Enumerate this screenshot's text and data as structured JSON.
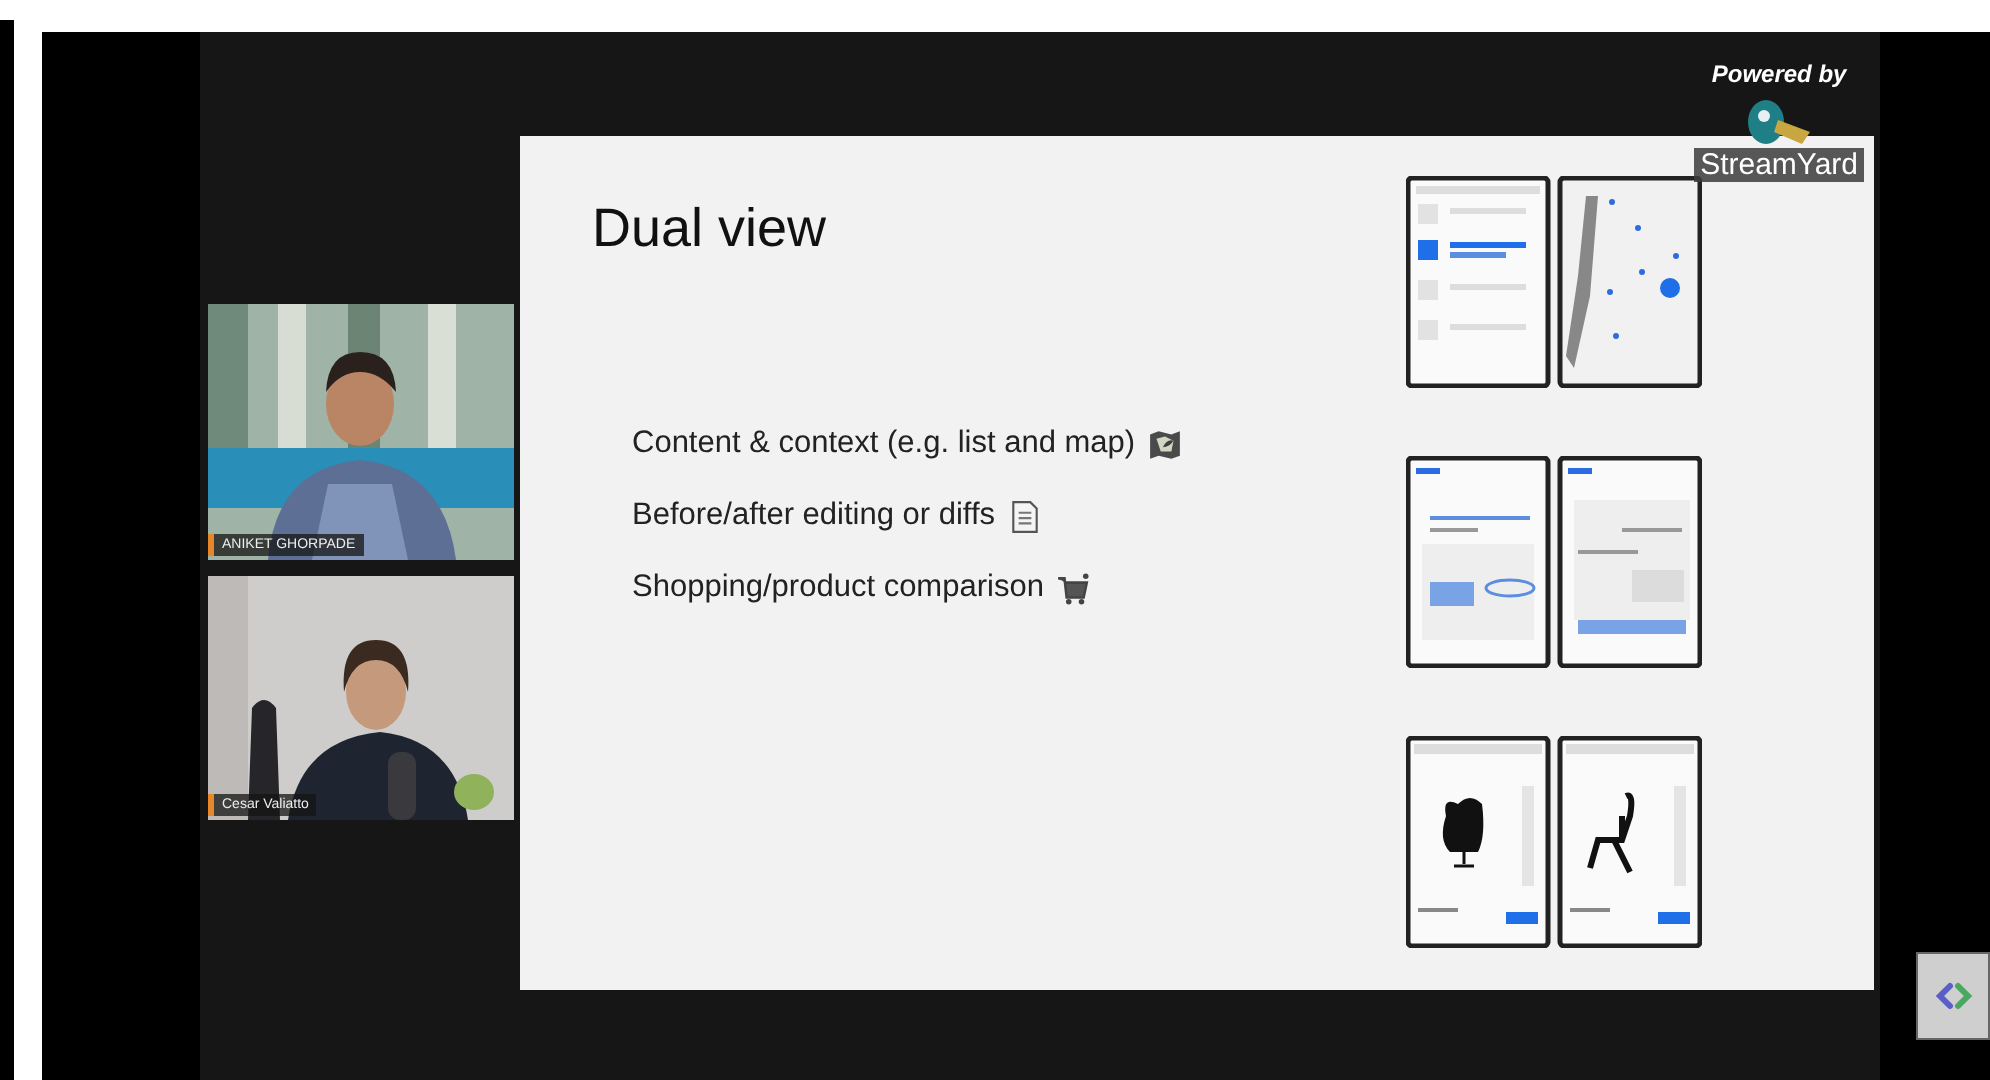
{
  "participants": [
    {
      "name": "ANIKET GHORPADE"
    },
    {
      "name": "Cesar Valiatto"
    }
  ],
  "branding": {
    "caption": "Powered by",
    "wordmark": "StreamYard"
  },
  "slide": {
    "title": "Dual view",
    "bullets": [
      {
        "text": "Content & context (e.g. list and map)",
        "kind": "map"
      },
      {
        "text": "Before/after editing or diffs",
        "kind": "document"
      },
      {
        "text": "Shopping/product comparison",
        "kind": "cart"
      }
    ],
    "mockups": [
      {
        "kind": "list-map"
      },
      {
        "kind": "document-diff"
      },
      {
        "kind": "product-compare"
      }
    ]
  }
}
